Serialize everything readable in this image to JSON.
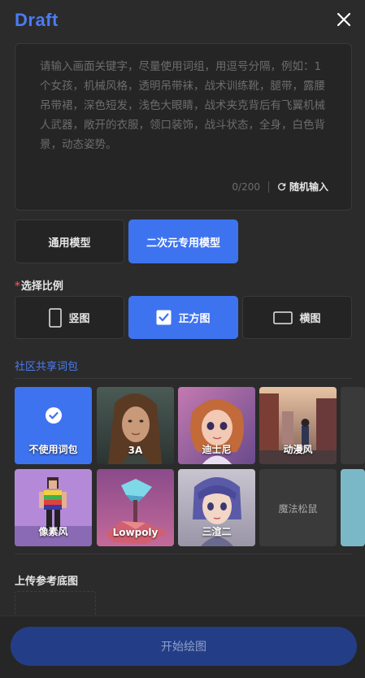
{
  "header": {
    "logo": "Draft",
    "close_icon": "close-icon"
  },
  "prompt": {
    "placeholder": "请输入画面关键字，尽量使用词组，用逗号分隔，例如：1个女孩，机械风格，透明吊带袜，战术训练靴，腿带，露腰吊带裙，深色短发，浅色大眼睛，战术夹克背后有飞翼机械人武器，敞开的衣服，领口装饰，战斗状态，全身，白色背景，动态姿势。",
    "value": "",
    "counter": "0/200",
    "random_label": "随机输入",
    "random_icon": "refresh-icon"
  },
  "models": {
    "tabs": [
      {
        "label": "通用模型",
        "active": false
      },
      {
        "label": "二次元专用模型",
        "active": true
      }
    ]
  },
  "ratio": {
    "required_mark": "*",
    "label": "选择比例",
    "options": [
      {
        "label": "竖图",
        "icon": "portrait-ratio-icon",
        "active": false
      },
      {
        "label": "正方图",
        "icon": "checkbox-checked-icon",
        "active": true
      },
      {
        "label": "横图",
        "icon": "landscape-ratio-icon",
        "active": false
      }
    ]
  },
  "community": {
    "title": "社区共享词包",
    "packs": [
      {
        "label": "不使用词包",
        "active": true,
        "icon": "check-circle-icon"
      },
      {
        "label": "3A",
        "active": false
      },
      {
        "label": "迪士尼",
        "active": false
      },
      {
        "label": "动漫风",
        "active": false
      },
      {
        "label": "像素风",
        "active": false
      },
      {
        "label": "Lowpoly",
        "active": false
      },
      {
        "label": "三渲二",
        "active": false
      },
      {
        "label": "魔法松鼠",
        "active": false
      }
    ]
  },
  "upload": {
    "label": "上传参考底图"
  },
  "actions": {
    "start_label": "开始绘图"
  },
  "colors": {
    "accent": "#3e73f0",
    "background": "#2b2b2b",
    "disabled_button": "#233e87",
    "required": "#e04848"
  }
}
